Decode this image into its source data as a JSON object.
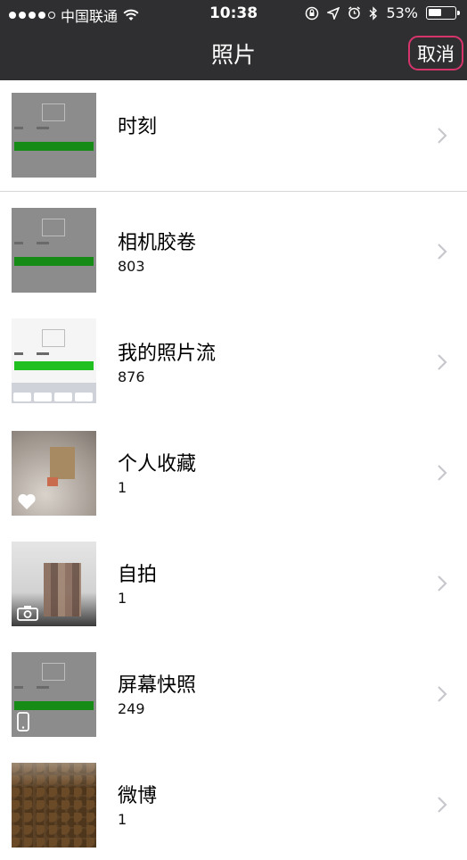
{
  "status_bar": {
    "carrier": "中国联通",
    "time": "10:38",
    "battery": "53%",
    "battery_level": 0.53
  },
  "nav": {
    "title": "照片",
    "cancel_label": "取消"
  },
  "albums": [
    {
      "title": "时刻",
      "count": "",
      "thumb_icon": ""
    },
    {
      "title": "相机胶卷",
      "count": "803",
      "thumb_icon": ""
    },
    {
      "title": "我的照片流",
      "count": "876",
      "thumb_icon": ""
    },
    {
      "title": "个人收藏",
      "count": "1",
      "thumb_icon": "heart-icon"
    },
    {
      "title": "自拍",
      "count": "1",
      "thumb_icon": "front-camera-icon"
    },
    {
      "title": "屏幕快照",
      "count": "249",
      "thumb_icon": "phone-icon"
    },
    {
      "title": "微博",
      "count": "1",
      "thumb_icon": ""
    }
  ]
}
